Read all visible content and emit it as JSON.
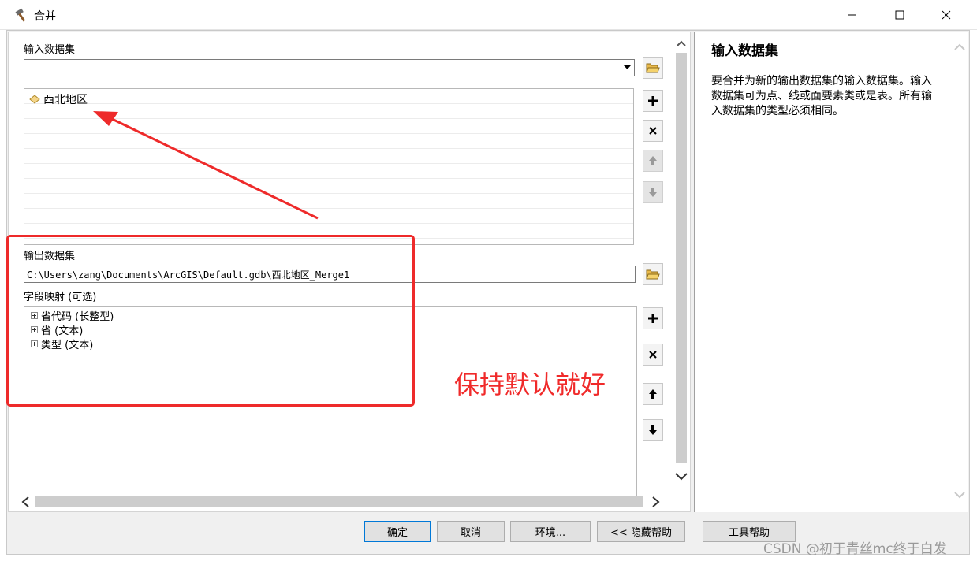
{
  "window": {
    "title": "合并"
  },
  "input_section": {
    "label": "输入数据集",
    "combo_value": "",
    "items": [
      "西北地区"
    ]
  },
  "output_section": {
    "label": "输出数据集",
    "path": "C:\\Users\\zang\\Documents\\ArcGIS\\Default.gdb\\西北地区_Merge1"
  },
  "field_map": {
    "label": "字段映射 (可选)",
    "fields": [
      "省代码 (长整型)",
      "省 (文本)",
      "类型 (文本)"
    ]
  },
  "help": {
    "title": "输入数据集",
    "body": "要合并为新的输出数据集的输入数据集。输入数据集可为点、线或面要素类或是表。所有输入数据集的类型必须相同。"
  },
  "buttons": {
    "ok": "确定",
    "cancel": "取消",
    "env": "环境...",
    "hide_help": "<< 隐藏帮助",
    "tool_help": "工具帮助"
  },
  "annotation": {
    "note": "保持默认就好",
    "watermark": "CSDN @初于青丝mc终于白发"
  },
  "colors": {
    "annotation_red": "#ee2a2a",
    "default_button_border": "#0078d7"
  }
}
